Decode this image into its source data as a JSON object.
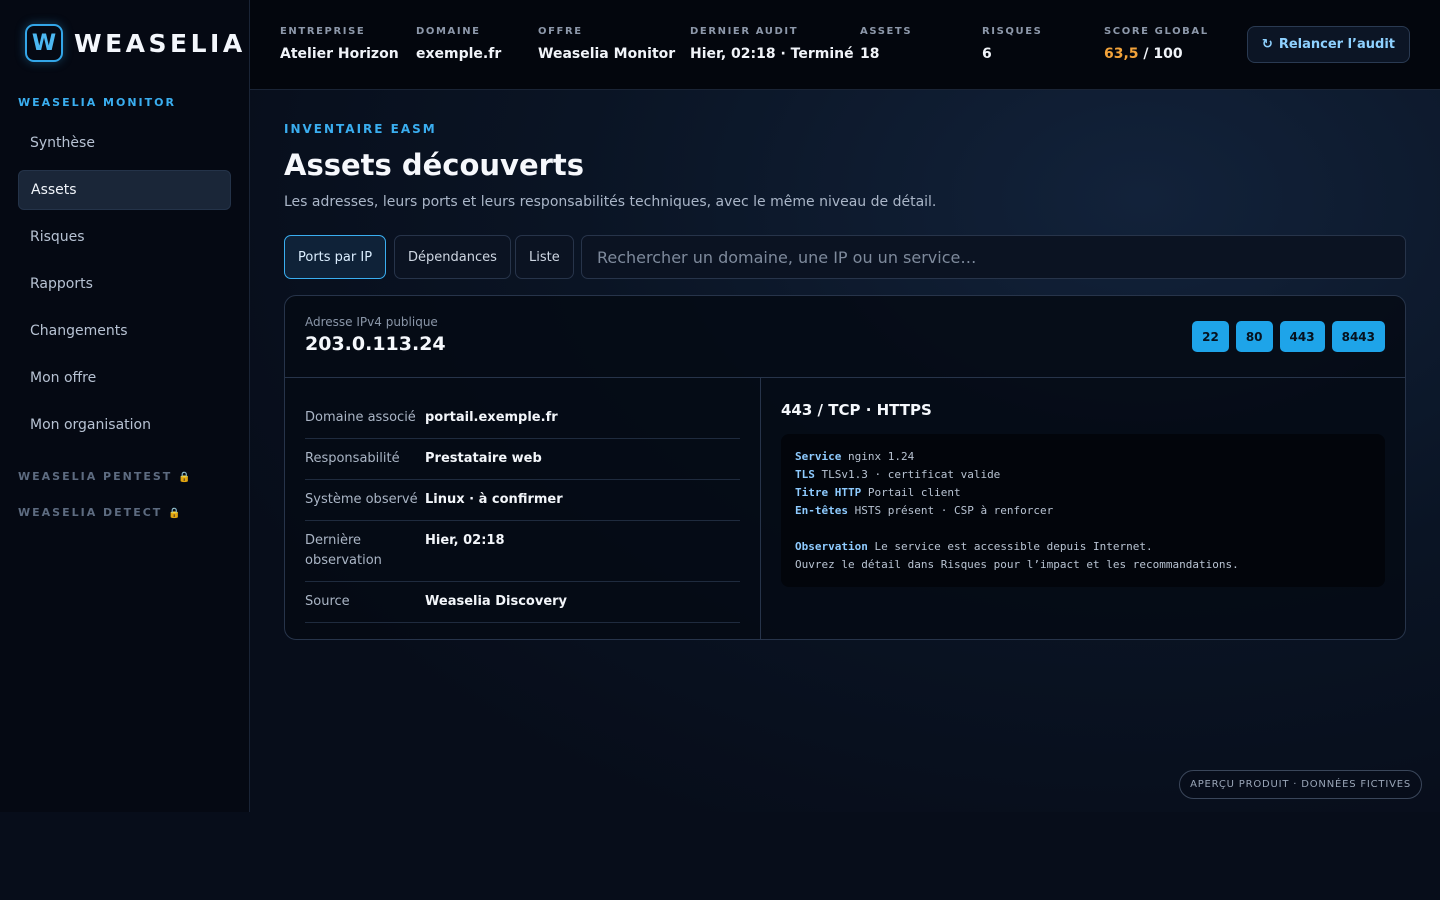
{
  "brand": {
    "mark": "W",
    "name": "WEASELIA"
  },
  "sidebar": {
    "section_active": "WEASELIA MONITOR",
    "items": [
      {
        "label": "Synthèse"
      },
      {
        "label": "Assets"
      },
      {
        "label": "Risques"
      },
      {
        "label": "Rapports"
      },
      {
        "label": "Changements"
      },
      {
        "label": "Mon offre"
      },
      {
        "label": "Mon organisation"
      }
    ],
    "locked_sections": [
      "WEASELIA PENTEST",
      "WEASELIA DETECT"
    ],
    "lock_glyph": "🔒"
  },
  "header": {
    "meta": [
      {
        "label": "ENTREPRISE",
        "value": "Atelier Horizon"
      },
      {
        "label": "DOMAINE",
        "value": "exemple.fr"
      },
      {
        "label": "OFFRE",
        "value": "Weaselia Monitor"
      },
      {
        "label": "DERNIER AUDIT",
        "value": "Hier, 02:18 · Terminé"
      },
      {
        "label": "ASSETS",
        "value": "18"
      },
      {
        "label": "RISQUES",
        "value": "6"
      }
    ],
    "score": {
      "label": "SCORE GLOBAL",
      "value": "63,5",
      "max": "/ 100",
      "color": "#f3a33a"
    },
    "rerun_icon": "↻",
    "rerun_label": "Relancer l’audit"
  },
  "main": {
    "eyebrow": "INVENTAIRE EASM",
    "title": "Assets découverts",
    "subtitle": "Les adresses, leurs ports et leurs responsabilités techniques, avec le même niveau de détail.",
    "tabs": [
      {
        "label": "Ports par IP"
      },
      {
        "label": "Dépendances"
      },
      {
        "label": "Liste"
      }
    ],
    "search_placeholder": "Rechercher un domaine, une IP ou un service…",
    "card": {
      "ip_label": "Adresse IPv4 publique",
      "ip_value": "203.0.113.24",
      "ports": [
        "22",
        "80",
        "443",
        "8443"
      ],
      "details": [
        {
          "key": "Domaine associé",
          "value": "portail.exemple.fr"
        },
        {
          "key": "Responsabilité",
          "value": "Prestataire web"
        },
        {
          "key": "Système observé",
          "value": "Linux · à confirmer"
        },
        {
          "key": "Dernière observation",
          "value": "Hier, 02:18"
        },
        {
          "key": "Source",
          "value": "Weaselia Discovery"
        }
      ],
      "service_title": "443 / TCP · HTTPS",
      "code_lines": [
        {
          "k": "Service",
          "v": "nginx 1.24"
        },
        {
          "k": "TLS",
          "v": "TLSv1.3 · certificat valide"
        },
        {
          "k": "Titre HTTP",
          "v": "Portail client"
        },
        {
          "k": "En-têtes",
          "v": "HSTS présent · CSP à renforcer"
        }
      ],
      "observation_key": "Observation",
      "observation_text": "Le service est accessible depuis Internet.",
      "observation_text2": "Ouvrez le détail dans Risques pour l’impact et les recommandations."
    }
  },
  "footer_badge": "APERÇU PRODUIT · DONNÉES FICTIVES"
}
